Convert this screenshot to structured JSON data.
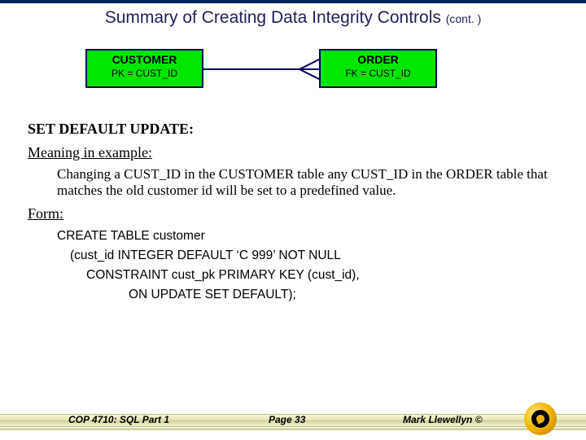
{
  "title": "Summary of Creating Data Integrity Controls",
  "title_cont": "(cont. )",
  "entities": {
    "left": {
      "name": "CUSTOMER",
      "key": "PK = CUST_ID"
    },
    "right": {
      "name": "ORDER",
      "key": "FK = CUST_ID"
    }
  },
  "section": "SET DEFAULT UPDATE:",
  "sub_meaning": "Meaning in example:",
  "meaning_text": "Changing a CUST_ID in the CUSTOMER table any CUST_ID in the ORDER table that matches the old customer id will be set to a predefined value.",
  "sub_form": "Form:",
  "sql": {
    "l1": "CREATE TABLE customer",
    "l2": "(cust_id  INTEGER DEFAULT ‘C 999’  NOT NULL",
    "l3": "CONSTRAINT cust_pk PRIMARY KEY (cust_id),",
    "l4": "ON UPDATE SET DEFAULT);"
  },
  "footer": {
    "left": "COP 4710: SQL Part 1",
    "mid": "Page 33",
    "right": "Mark Llewellyn ©"
  }
}
